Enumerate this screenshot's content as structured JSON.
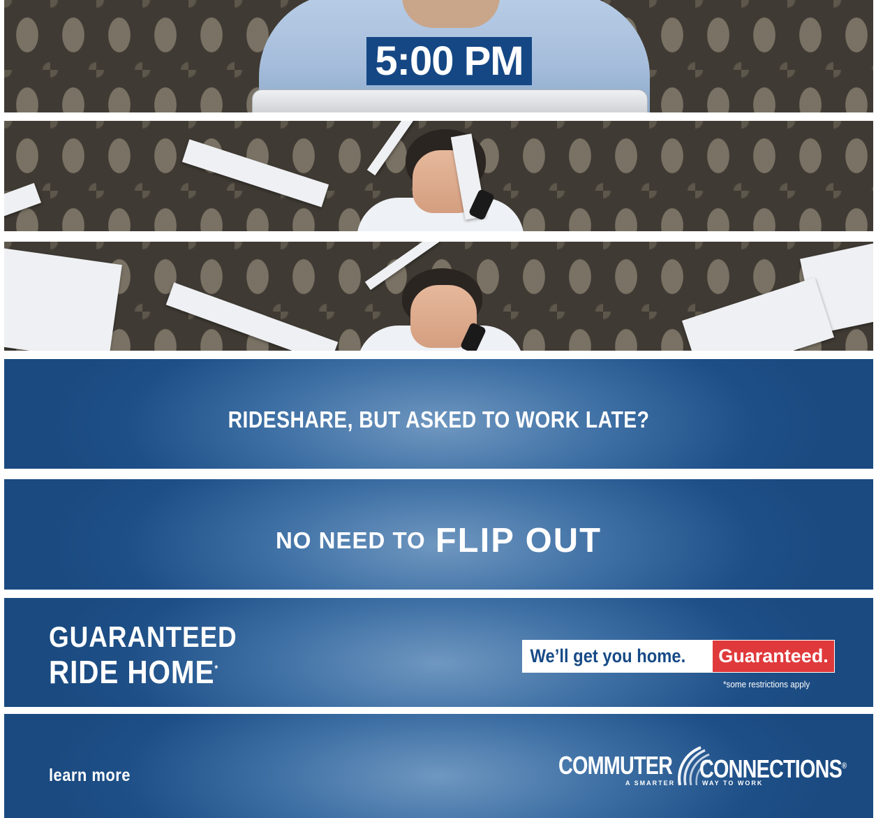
{
  "panel1": {
    "clock_text": "5:00 PM"
  },
  "panel4": {
    "question": "RIDESHARE, BUT ASKED TO WORK LATE?"
  },
  "panel5": {
    "lead": "NO NEED TO",
    "emphasis": "FLIP OUT"
  },
  "panel6": {
    "title_line1": "GUARANTEED",
    "title_line2": "RIDE HOME",
    "asterisk": "*",
    "tagline_left": "We’ll get you home.",
    "tagline_right": "Guaranteed.",
    "disclaimer": "*some restrictions apply"
  },
  "panel7": {
    "learn_more": "learn more",
    "logo_word1": "COMMUTER",
    "logo_word2": "CONNECTIONS",
    "logo_mark": "®",
    "logo_strap1": "A SMARTER",
    "logo_strap2": "WAY TO WORK"
  },
  "colors": {
    "navy": "#154784",
    "blue_panel": "#1e4f87",
    "red": "#e0393b",
    "white": "#ffffff"
  },
  "icons": [
    "commuter-connections-swoosh-icon"
  ]
}
